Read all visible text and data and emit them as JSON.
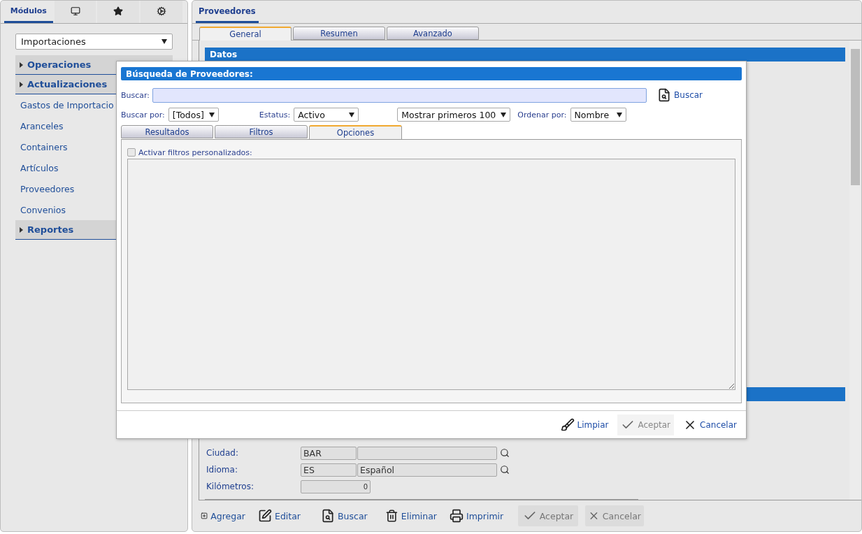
{
  "sidebar": {
    "tabs": [
      {
        "kind": "text",
        "label": "Módulos",
        "selected": true
      },
      {
        "kind": "monitor",
        "selected": false
      },
      {
        "kind": "star",
        "selected": false
      },
      {
        "kind": "gears",
        "selected": false
      }
    ],
    "module_select": {
      "value": "Importaciones"
    },
    "menu": [
      {
        "label": "Operaciones"
      },
      {
        "label": "Actualizaciones",
        "children": [
          {
            "label": "Gastos de Importacio"
          },
          {
            "label": "Aranceles"
          },
          {
            "label": "Containers"
          },
          {
            "label": "Artículos"
          },
          {
            "label": "Proveedores"
          },
          {
            "label": "Convenios"
          }
        ]
      },
      {
        "label": "Reportes"
      }
    ]
  },
  "main": {
    "title": "Proveedores",
    "tabs": [
      {
        "label": "General",
        "selected": true
      },
      {
        "label": "Resumen",
        "selected": false
      },
      {
        "label": "Avanzado",
        "selected": false
      }
    ],
    "section_title": "Datos",
    "fields": [
      {
        "kind": "lookup",
        "label": "Ciudad:",
        "code": "BAR"
      },
      {
        "kind": "lookup",
        "label": "Idioma:",
        "code": "ES",
        "name": "Español"
      },
      {
        "kind": "number",
        "label": "Kilómetros:",
        "value": "0"
      }
    ],
    "toolbar": [
      {
        "kind": "add",
        "label": "Agregar",
        "disabled": false
      },
      {
        "kind": "edit",
        "label": "Editar",
        "disabled": false
      },
      {
        "kind": "search",
        "label": "Buscar",
        "disabled": false
      },
      {
        "kind": "delete",
        "label": "Eliminar",
        "disabled": false
      },
      {
        "kind": "print",
        "label": "Imprimir",
        "disabled": false
      },
      {
        "kind": "accept",
        "label": "Aceptar",
        "disabled": true
      },
      {
        "kind": "cancel",
        "label": "Cancelar",
        "disabled": true
      }
    ]
  },
  "dialog": {
    "title": "Búsqueda de Proveedores:",
    "search": {
      "label": "Buscar:",
      "button": "Buscar"
    },
    "filters": [
      {
        "label": "Buscar por:",
        "value": "[Todos]"
      },
      {
        "label": "Estatus:",
        "value": "Activo"
      },
      {
        "value": "Mostrar primeros 100"
      },
      {
        "label": "Ordenar por:",
        "value": "Nombre"
      }
    ],
    "tabs": [
      {
        "label": "Resultados",
        "selected": false
      },
      {
        "label": "Filtros",
        "selected": false
      },
      {
        "label": "Opciones",
        "selected": true
      }
    ],
    "custom_filters": {
      "label": "Activar filtros personalizados:",
      "checked": false
    },
    "buttons": [
      {
        "kind": "clear",
        "label": "Limpiar",
        "disabled": false
      },
      {
        "kind": "accept",
        "label": "Aceptar",
        "disabled": true
      },
      {
        "kind": "cancel",
        "label": "Cancelar",
        "disabled": false
      }
    ]
  }
}
